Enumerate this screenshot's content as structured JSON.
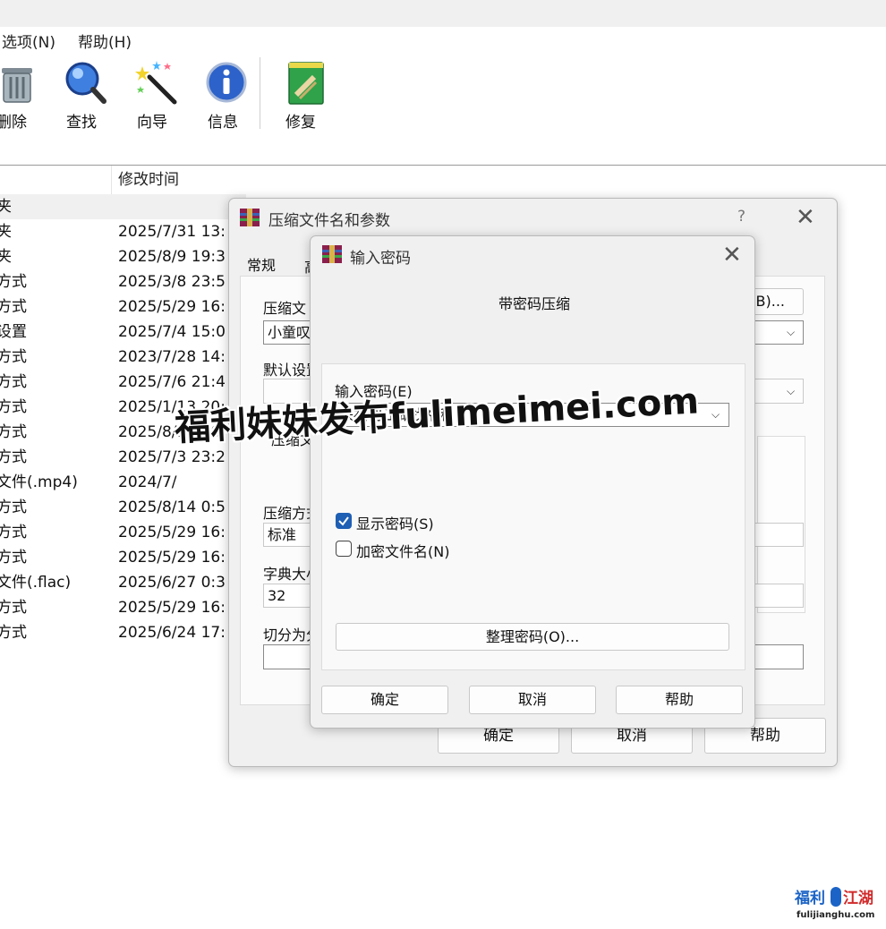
{
  "menu": {
    "options": "选项(N)",
    "help": "帮助(H)"
  },
  "toolbar": {
    "delete": "删除",
    "find": "查找",
    "wizard": "向导",
    "info": "信息",
    "repair": "修复"
  },
  "filelist": {
    "col_modified": "修改时间",
    "rows": [
      {
        "type": "夹",
        "modified": ""
      },
      {
        "type": "夹",
        "modified": "2025/7/31 13:"
      },
      {
        "type": "夹",
        "modified": "2025/8/9 19:3"
      },
      {
        "type": "方式",
        "modified": "2025/3/8 23:5"
      },
      {
        "type": "方式",
        "modified": "2025/5/29 16:"
      },
      {
        "type": "设置",
        "modified": "2025/7/4 15:0"
      },
      {
        "type": "方式",
        "modified": "2023/7/28 14:"
      },
      {
        "type": "方式",
        "modified": "2025/7/6 21:4"
      },
      {
        "type": "方式",
        "modified": "2025/1/13 20:"
      },
      {
        "type": "方式",
        "modified": "2025/8/15 10:"
      },
      {
        "type": "方式",
        "modified": "2025/7/3 23:2"
      },
      {
        "type": "文件(.mp4)",
        "modified": "2024/7/"
      },
      {
        "type": "方式",
        "modified": "2025/8/14 0:5"
      },
      {
        "type": "方式",
        "modified": "2025/5/29 16:"
      },
      {
        "type": "方式",
        "modified": "2025/5/29 16:"
      },
      {
        "type": "文件(.flac)",
        "modified": "2025/6/27 0:3"
      },
      {
        "type": "方式",
        "modified": "2025/5/29 16:"
      },
      {
        "type": "方式",
        "modified": "2025/6/24 17:"
      }
    ]
  },
  "archive_dialog": {
    "title": "压缩文件名和参数",
    "help_glyph": "?",
    "tab_general": "常规",
    "tab_advanced": "高",
    "archive_name_label": "压缩文",
    "archive_name_value": "小童叹",
    "browse_button": "(B)...",
    "default_settings_label": "默认设置",
    "compress_options_label": "压缩文",
    "method_label": "压缩方式",
    "method_value": "标准",
    "dict_label": "字典大小",
    "dict_value": "32",
    "split_label": "切分为分",
    "ok": "确定",
    "cancel": "取消",
    "help": "帮助"
  },
  "password_dialog": {
    "title": "输入密码",
    "heading": "带密码压缩",
    "password_label": "输入密码(E)",
    "password_value": "来福利江湖找福利",
    "show_password": "显示密码(S)",
    "show_password_checked": true,
    "encrypt_names": "加密文件名(N)",
    "encrypt_names_checked": false,
    "organize": "整理密码(O)...",
    "ok": "确定",
    "cancel": "取消",
    "help": "帮助"
  },
  "watermark": "福利妹妹发布fulimeimei.com",
  "corner_logo": {
    "title": "福利江湖",
    "url": "fulijianghu.com"
  }
}
